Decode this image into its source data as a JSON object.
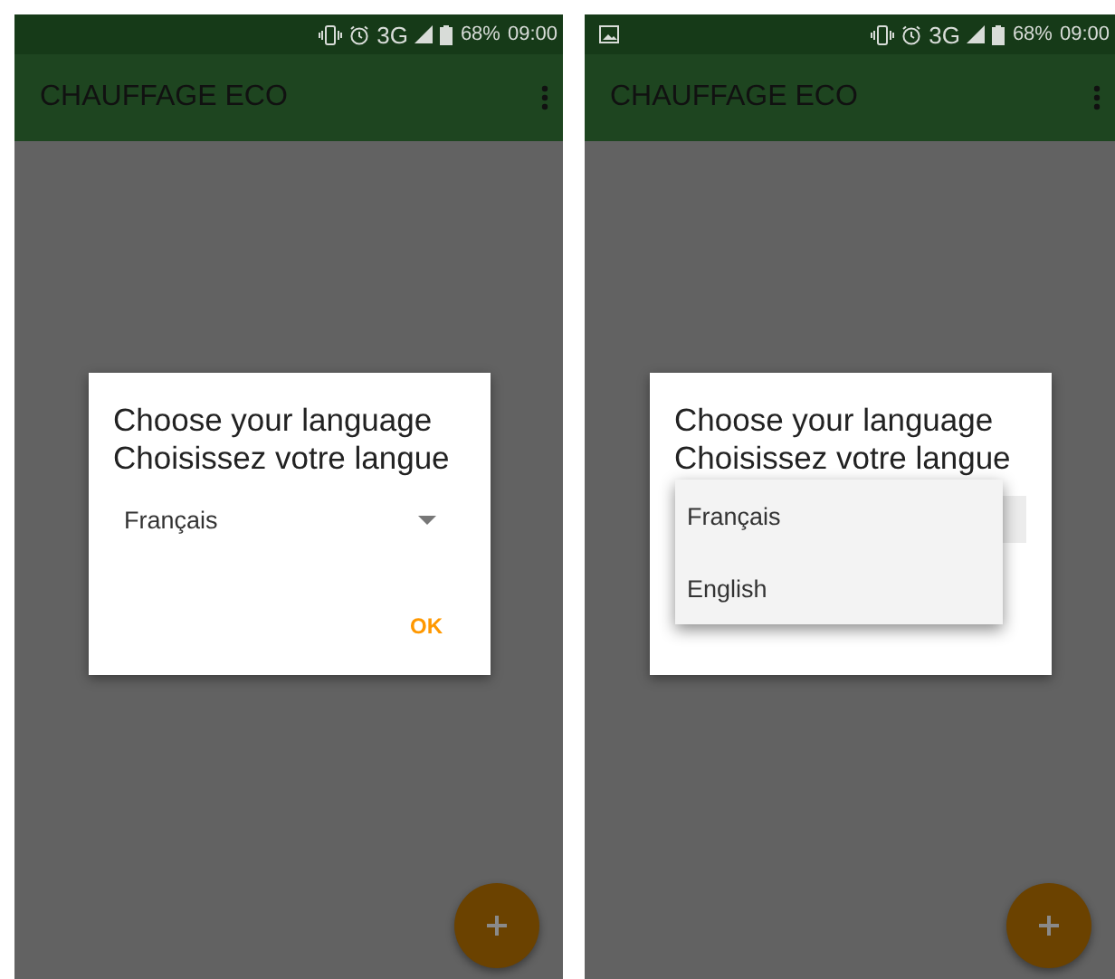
{
  "screens": [
    {
      "status_bar": {
        "notification_icon": false,
        "network": "3G",
        "battery": "68%",
        "time": "09:00"
      },
      "app_bar": {
        "title": "CHAUFFAGE ECO"
      },
      "dialog": {
        "title_lines": [
          "Choose your language",
          "Choisissez votre langue"
        ],
        "spinner": {
          "value": "Français",
          "expanded": false
        },
        "ok": "OK"
      }
    },
    {
      "status_bar": {
        "notification_icon": true,
        "network": "3G",
        "battery": "68%",
        "time": "09:00"
      },
      "app_bar": {
        "title": "CHAUFFAGE ECO"
      },
      "dialog": {
        "title_lines": [
          "Choose your language",
          "Choisissez votre langue"
        ],
        "spinner": {
          "expanded": true,
          "options": [
            "Français",
            "English"
          ]
        }
      }
    }
  ]
}
